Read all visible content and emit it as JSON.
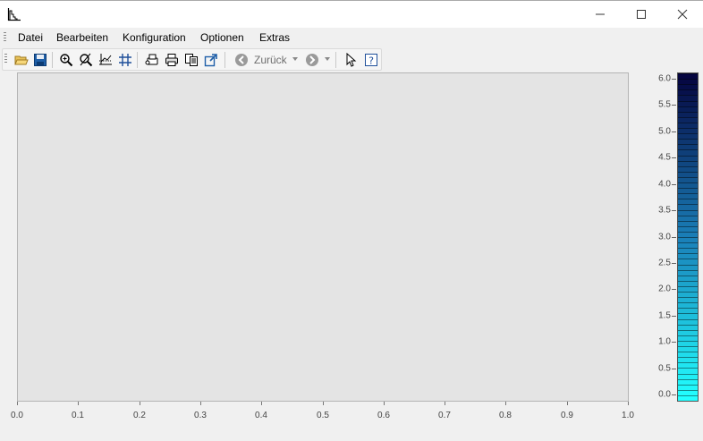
{
  "menu": {
    "items": [
      "Datei",
      "Bearbeiten",
      "Konfiguration",
      "Optionen",
      "Extras"
    ]
  },
  "toolbar": {
    "back_label": "Zurück"
  },
  "plot": {
    "x_ticks": [
      "0.0",
      "0.1",
      "0.2",
      "0.3",
      "0.4",
      "0.5",
      "0.6",
      "0.7",
      "0.8",
      "0.9",
      "1.0"
    ],
    "colorbar_ticks": [
      "6.0",
      "5.5",
      "5.0",
      "4.5",
      "4.0",
      "3.5",
      "3.0",
      "2.5",
      "2.0",
      "1.5",
      "1.0",
      "0.5",
      "0.0"
    ],
    "colorbar_colors": {
      "top": "#050540",
      "mid": "#1a7fb8",
      "bottom": "#22ffff"
    }
  }
}
